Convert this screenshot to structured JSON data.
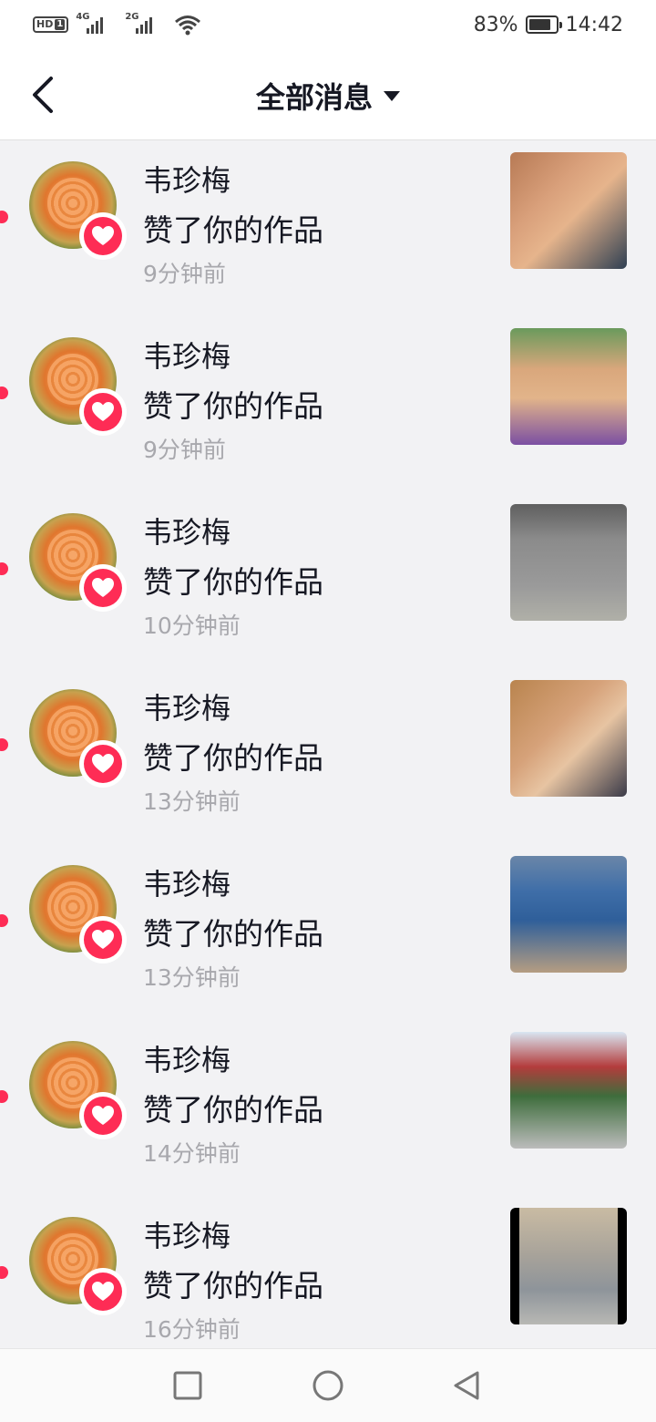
{
  "status_bar": {
    "hd_label": "HD",
    "sim_label": "1",
    "net1": "4G",
    "net2": "2G",
    "battery_percent_text": "83%",
    "battery_level": 0.83,
    "time": "14:42"
  },
  "header": {
    "title": "全部消息"
  },
  "icons": {
    "back": "chevron-left-icon",
    "title_dropdown": "caret-down-icon",
    "like": "heart-icon",
    "nav_recent": "square-icon",
    "nav_home": "circle-icon",
    "nav_back": "triangle-left-icon"
  },
  "colors": {
    "accent": "#fe2c55",
    "text_primary": "#161823",
    "text_secondary": "#a8a8ad",
    "background": "#f2f2f4"
  },
  "notifications": [
    {
      "name": "韦珍梅",
      "action": "赞了你的作品",
      "time": "9分钟前",
      "unread": true
    },
    {
      "name": "韦珍梅",
      "action": "赞了你的作品",
      "time": "9分钟前",
      "unread": true
    },
    {
      "name": "韦珍梅",
      "action": "赞了你的作品",
      "time": "10分钟前",
      "unread": true
    },
    {
      "name": "韦珍梅",
      "action": "赞了你的作品",
      "time": "13分钟前",
      "unread": true
    },
    {
      "name": "韦珍梅",
      "action": "赞了你的作品",
      "time": "13分钟前",
      "unread": true
    },
    {
      "name": "韦珍梅",
      "action": "赞了你的作品",
      "time": "14分钟前",
      "unread": true
    },
    {
      "name": "韦珍梅",
      "action": "赞了你的作品",
      "time": "16分钟前",
      "unread": true
    }
  ]
}
